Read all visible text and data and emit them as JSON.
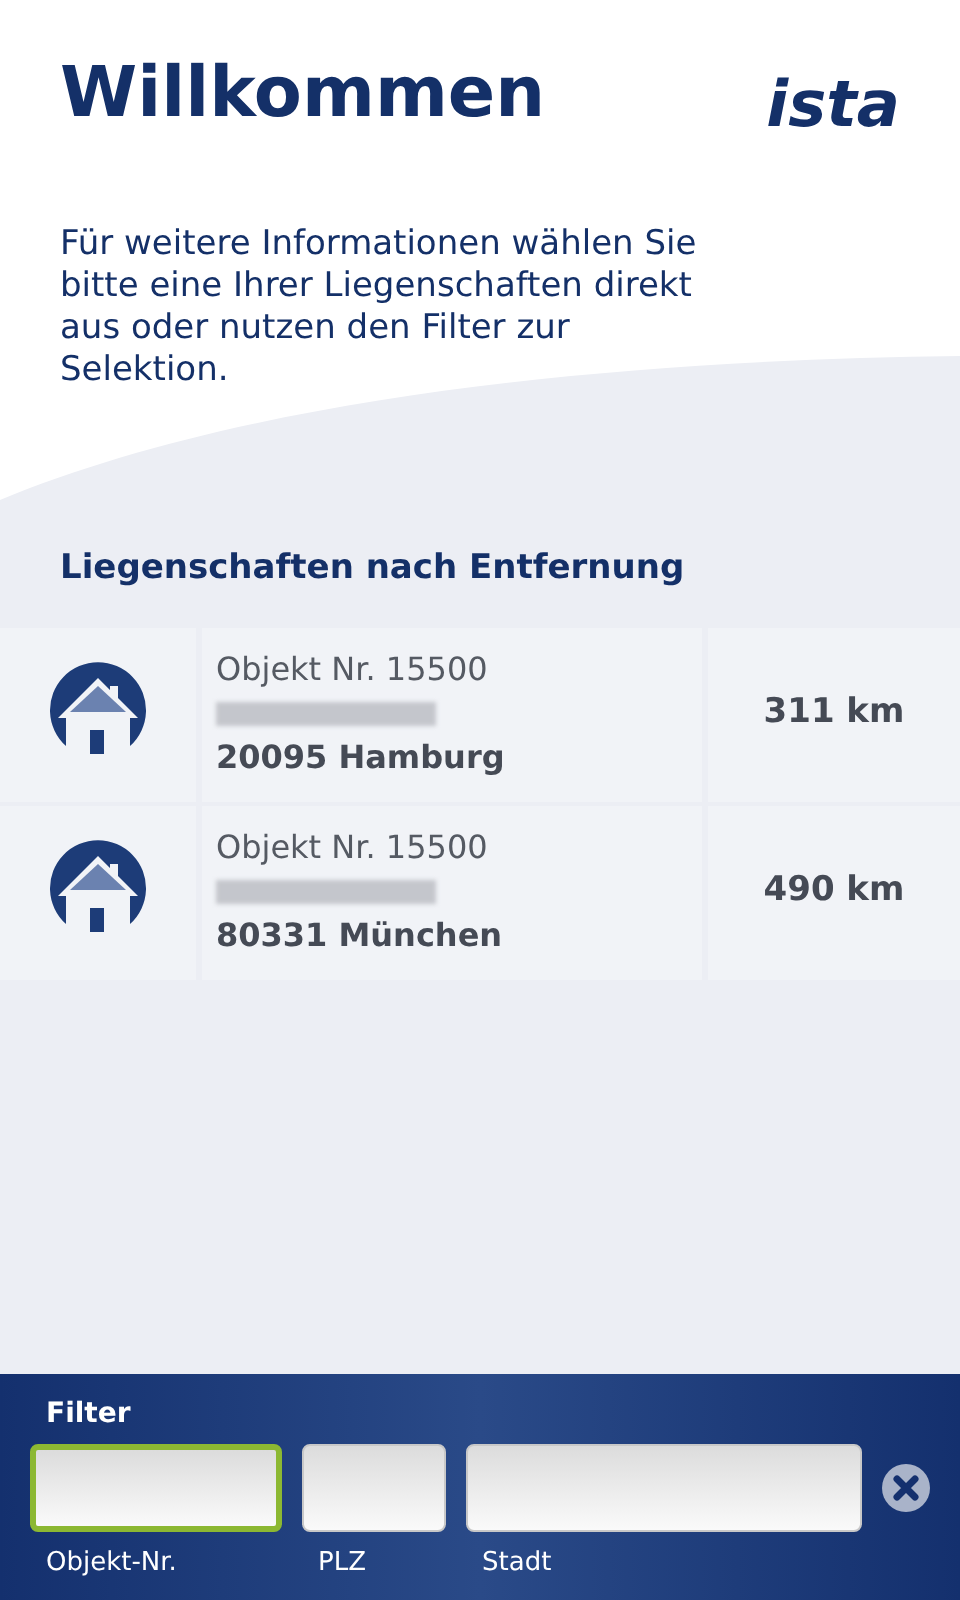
{
  "header": {
    "title": "Willkommen",
    "logo": "ista"
  },
  "intro": "Für weitere Informationen wählen Sie bitte eine Ihrer Liegenschaften direkt aus oder nutzen den Filter zur Selektion.",
  "section_title": "Liegenschaften nach Entfernung",
  "properties": [
    {
      "object_no": "Objekt Nr. 15500",
      "city": "20095 Hamburg",
      "distance": "311 km"
    },
    {
      "object_no": "Objekt Nr. 15500",
      "city": "80331 München",
      "distance": "490 km"
    }
  ],
  "filter": {
    "title": "Filter",
    "fields": [
      {
        "label": "Objekt-Nr.",
        "focused": true
      },
      {
        "label": "PLZ",
        "focused": false
      },
      {
        "label": "Stadt",
        "focused": false
      }
    ]
  }
}
